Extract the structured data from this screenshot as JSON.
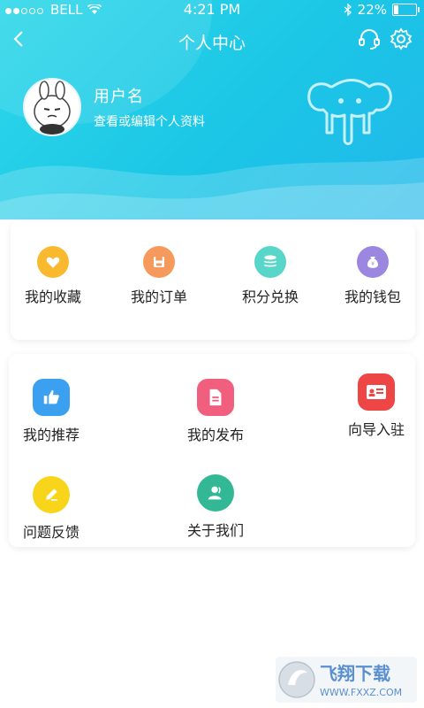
{
  "status": {
    "carrier": "BELL",
    "time": "4:21 PM",
    "battery": "22%",
    "battery_level": 0.22
  },
  "nav": {
    "title": "个人中心"
  },
  "profile": {
    "username": "用户名",
    "subtitle": "查看或编辑个人资料"
  },
  "quick_actions": [
    {
      "label": "我的收藏",
      "icon": "heart-icon",
      "color": "#f8b92e"
    },
    {
      "label": "我的订单",
      "icon": "save-icon",
      "color": "#f59a5c"
    },
    {
      "label": "积分兑换",
      "icon": "coins-icon",
      "color": "#57d6c9"
    },
    {
      "label": "我的钱包",
      "icon": "wallet-icon",
      "color": "#9b86e0"
    }
  ],
  "features": [
    {
      "label": "我的推荐",
      "icon": "thumbs-up-icon",
      "color": "#3aa0ef"
    },
    {
      "label": "我的发布",
      "icon": "document-icon",
      "color": "#f0607e"
    },
    {
      "label": "向导入驻",
      "icon": "id-card-icon",
      "color": "#ee4545"
    },
    {
      "label": "问题反馈",
      "icon": "pencil-icon",
      "color": "#f8d51a"
    },
    {
      "label": "关于我们",
      "icon": "user-icon",
      "color": "#33b896"
    }
  ],
  "watermark": {
    "text": "飞翔下载",
    "url": "WWW.FXXZ.COM"
  },
  "colors": {
    "header": "#1bc6e6"
  }
}
